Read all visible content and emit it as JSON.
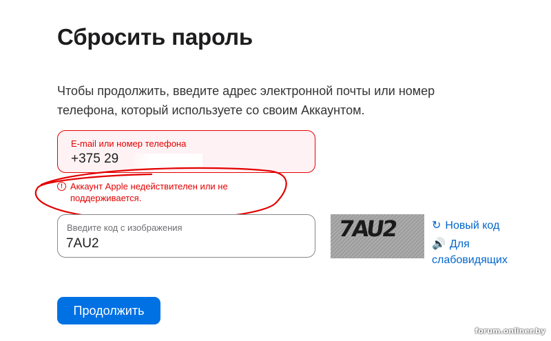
{
  "page": {
    "title": "Сбросить пароль",
    "intro": "Чтобы продолжить, введите адрес электронной почты или номер телефона, который используете со своим Аккаунтом."
  },
  "account_field": {
    "label": "E-mail или номер телефона",
    "value": "+375 29"
  },
  "error": {
    "text": "Аккаунт Apple недействителен или не поддерживается.",
    "icon": "exclamation-circle-icon"
  },
  "captcha": {
    "label": "Введите код с изображения",
    "value": "7AU2",
    "image_text": "7AU2",
    "new_code_label": "Новый код",
    "audio_label": "Для слабовидящих"
  },
  "continue_button": {
    "label": "Продолжить"
  },
  "watermark": "forum.onliner.by",
  "colors": {
    "accent": "#0071e3",
    "link": "#0066cc",
    "error": "#e30000",
    "error_background": "#fff2f4"
  }
}
